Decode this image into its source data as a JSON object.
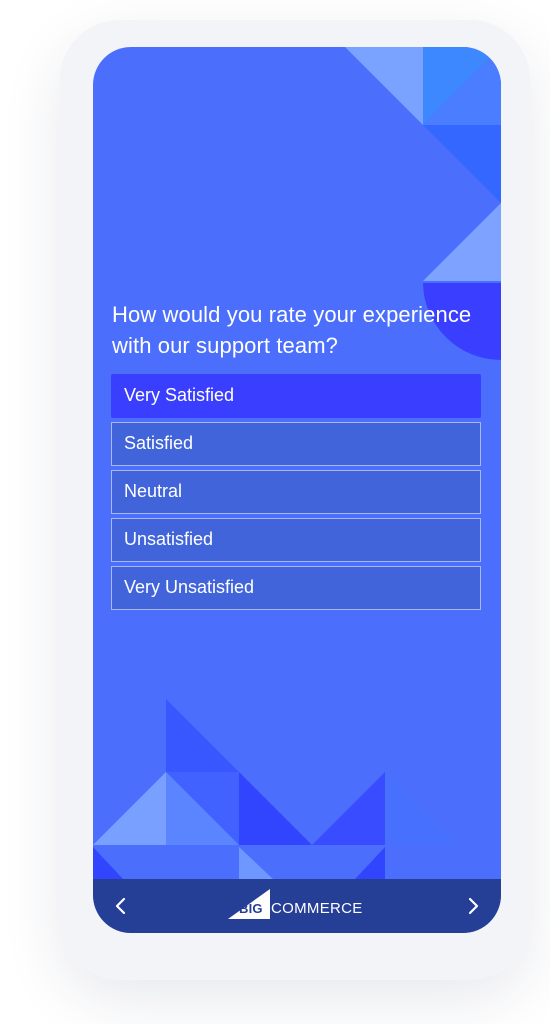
{
  "survey": {
    "question": "How would you rate your experience with our support team?",
    "options": [
      {
        "label": "Very Satisfied",
        "selected": true
      },
      {
        "label": "Satisfied",
        "selected": false
      },
      {
        "label": "Neutral",
        "selected": false
      },
      {
        "label": "Unsatisfied",
        "selected": false
      },
      {
        "label": "Very Unsatisfied",
        "selected": false
      }
    ]
  },
  "footer": {
    "prev_icon": "chevron-left-icon",
    "next_icon": "chevron-right-icon",
    "brand_big": "BIG",
    "brand_rest": "COMMERCE"
  },
  "colors": {
    "background": "#4b6ffc",
    "selected_option": "#3a3eff",
    "option": "#4264db",
    "navbar": "#263f96"
  }
}
